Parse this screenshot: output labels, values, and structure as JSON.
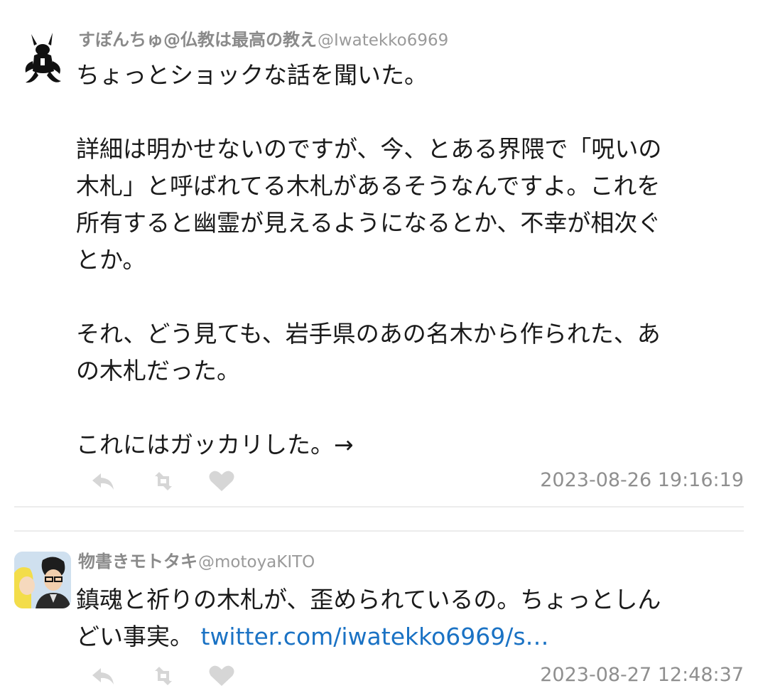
{
  "tweets": [
    {
      "display_name": "すぽんちゅ@仏教は最高の教え",
      "handle": "@Iwatekko6969",
      "body": "ちょっとショックな話を聞いた。\n\n詳細は明かせないのですが、今、とある界隈で「呪いの\n木札」と呼ばれてる木札があるそうなんですよ。これを\n所有すると幽霊が見えるようになるとか、不幸が相次ぐ\nとか。\n\nそれ、どう見ても、岩手県のあの名木から作られた、あ\nの木札だった。\n\nこれにはガッカリした。→",
      "timestamp": "2023-08-26 19:16:19",
      "avatar_icon": "demon-figure-avatar"
    },
    {
      "display_name": "物書きモトタキ",
      "handle": "@motoyaKITO",
      "body": "鎮魂と祈りの木札が、歪められているの。ちょっとしん\nどい事実。 ",
      "link": "twitter.com/iwatekko6969/s…",
      "timestamp": "2023-08-27 12:48:37",
      "avatar_icon": "manga-character-avatar"
    }
  ],
  "action_icons": [
    "reply-icon",
    "retweet-icon",
    "like-icon"
  ],
  "colors": {
    "name": "#8a8a8a",
    "text": "#1a1a1a",
    "link": "#1a72c4",
    "icon": "#d6d6d6",
    "divider": "#ececec"
  }
}
